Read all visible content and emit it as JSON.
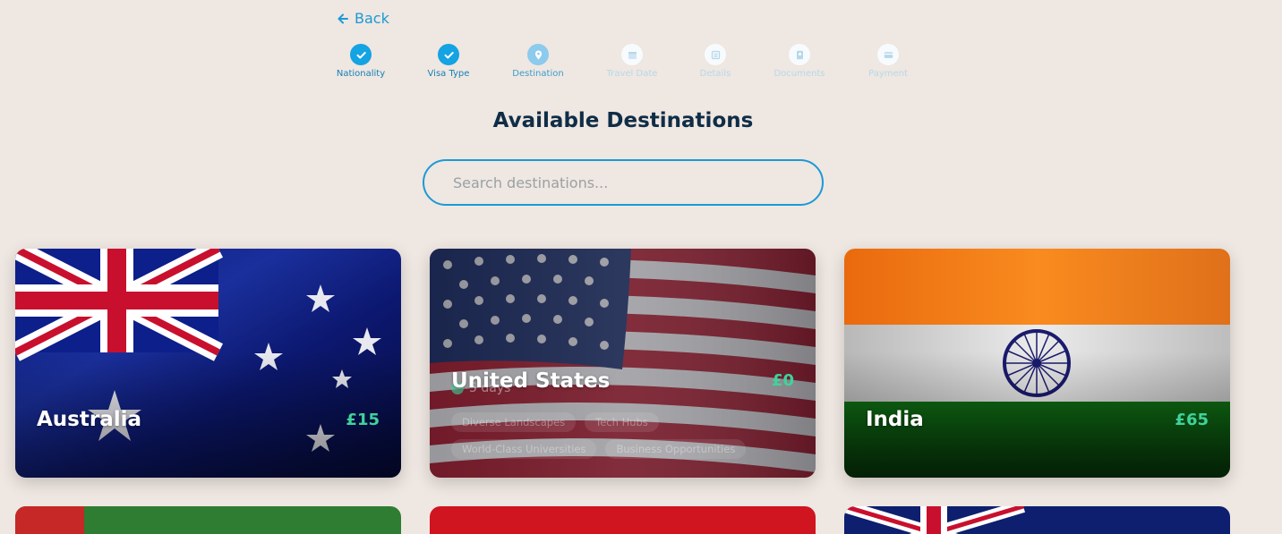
{
  "nav": {
    "back_label": "Back"
  },
  "steps": [
    {
      "label": "Nationality",
      "state": "done",
      "icon": "check-icon"
    },
    {
      "label": "Visa Type",
      "state": "done",
      "icon": "check-icon"
    },
    {
      "label": "Destination",
      "state": "current",
      "icon": "location-pin-icon"
    },
    {
      "label": "Travel Date",
      "state": "todo",
      "icon": "calendar-icon"
    },
    {
      "label": "Details",
      "state": "todo",
      "icon": "list-icon"
    },
    {
      "label": "Documents",
      "state": "todo",
      "icon": "passport-icon"
    },
    {
      "label": "Payment",
      "state": "todo",
      "icon": "credit-card-icon"
    }
  ],
  "page": {
    "title": "Available Destinations"
  },
  "search": {
    "placeholder": "Search destinations..."
  },
  "destinations": [
    {
      "name": "Australia",
      "price": "£15"
    },
    {
      "name": "United States",
      "price": "£0",
      "processing": "5 days",
      "tags": [
        "Diverse Landscapes",
        "Tech Hubs",
        "World-Class Universities",
        "Business Opportunities"
      ]
    },
    {
      "name": "India",
      "price": "£65"
    }
  ],
  "colors": {
    "accent": "#1b9ad6",
    "price": "#3fd39b",
    "background": "#efe7e1",
    "title": "#0f2d47"
  }
}
